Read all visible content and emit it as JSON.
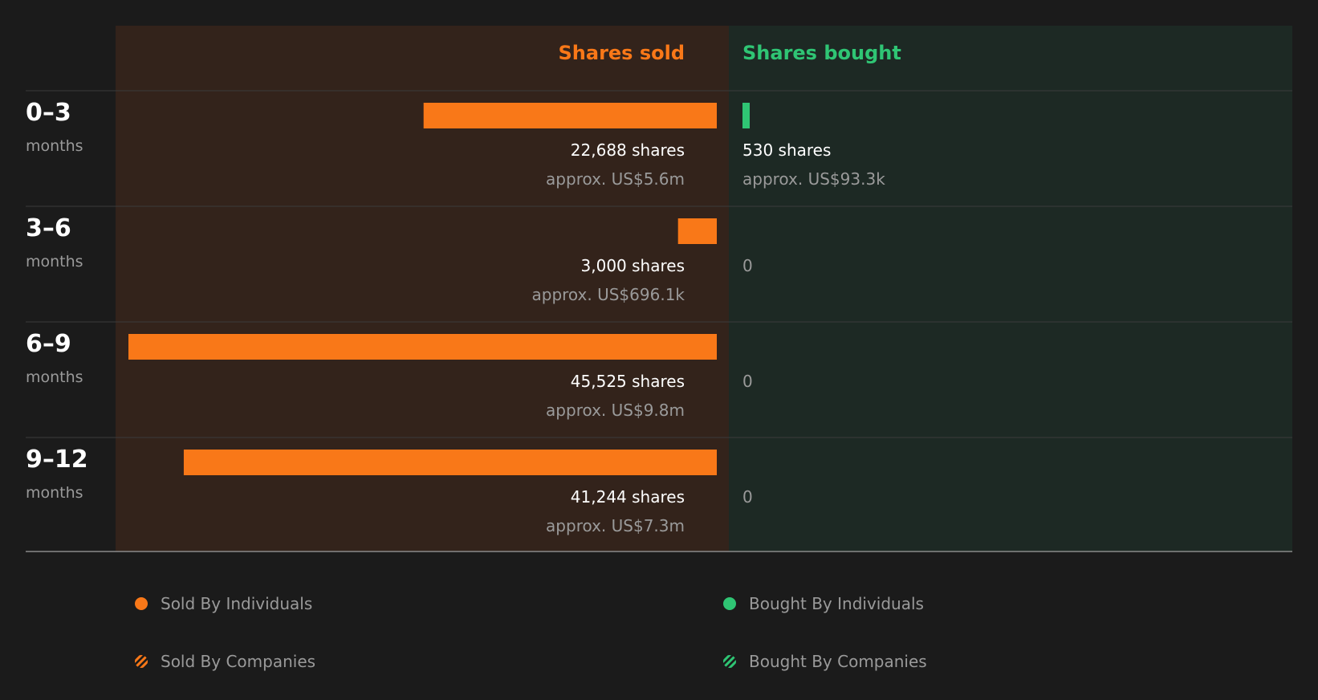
{
  "colors": {
    "sold": "#f97818",
    "bought": "#2fc574",
    "sold_panel": "#33231b",
    "bought_panel": "#1d2924",
    "divider": "#3b3b3b"
  },
  "chart_data": {
    "type": "bar",
    "orientation": "horizontal-diverging",
    "columns": {
      "sold": "Shares sold",
      "bought": "Shares bought"
    },
    "rows": [
      {
        "period": "0–3",
        "unit": "months",
        "sold": 22688,
        "sold_label": "22,688 shares",
        "sold_value": "approx. US$5.6m",
        "bought": 530,
        "bought_label": "530 shares",
        "bought_value": "approx. US$93.3k"
      },
      {
        "period": "3–6",
        "unit": "months",
        "sold": 3000,
        "sold_label": "3,000 shares",
        "sold_value": "approx. US$696.1k",
        "bought": 0,
        "bought_label": "0",
        "bought_value": ""
      },
      {
        "period": "6–9",
        "unit": "months",
        "sold": 45525,
        "sold_label": "45,525 shares",
        "sold_value": "approx. US$9.8m",
        "bought": 0,
        "bought_label": "0",
        "bought_value": ""
      },
      {
        "period": "9–12",
        "unit": "months",
        "sold": 41244,
        "sold_label": "41,244 shares",
        "sold_value": "approx. US$7.3m",
        "bought": 0,
        "bought_label": "0",
        "bought_value": ""
      }
    ],
    "legend": [
      {
        "label": "Sold By Individuals",
        "style": "solid",
        "color": "#f97818"
      },
      {
        "label": "Bought By Individuals",
        "style": "solid",
        "color": "#2fc574"
      },
      {
        "label": "Sold By Companies",
        "style": "striped",
        "color": "#f97818"
      },
      {
        "label": "Bought By Companies",
        "style": "striped",
        "color": "#2fc574"
      }
    ]
  }
}
